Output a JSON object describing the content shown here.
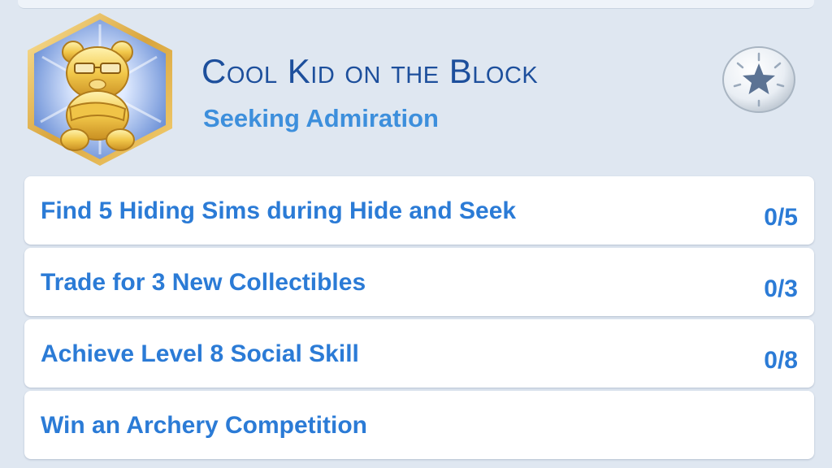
{
  "aspiration": {
    "title": "Cool Kid on the Block",
    "subtitle": "Seeking Admiration",
    "badge_icon": "golden-teddy-bear-with-sunglasses-icon",
    "action_icon": "star-icon"
  },
  "tasks": [
    {
      "label": "Find 5 Hiding Sims during Hide and Seek",
      "progress": "0/5"
    },
    {
      "label": "Trade for 3 New Collectibles",
      "progress": "0/3"
    },
    {
      "label": "Achieve Level 8 Social Skill",
      "progress": "0/8"
    },
    {
      "label": "Win an Archery Competition",
      "progress": ""
    }
  ],
  "colors": {
    "background": "#dfe7f1",
    "title": "#1d4f9c",
    "accent": "#2b7bd6",
    "badge_border": "#e2b85a"
  }
}
